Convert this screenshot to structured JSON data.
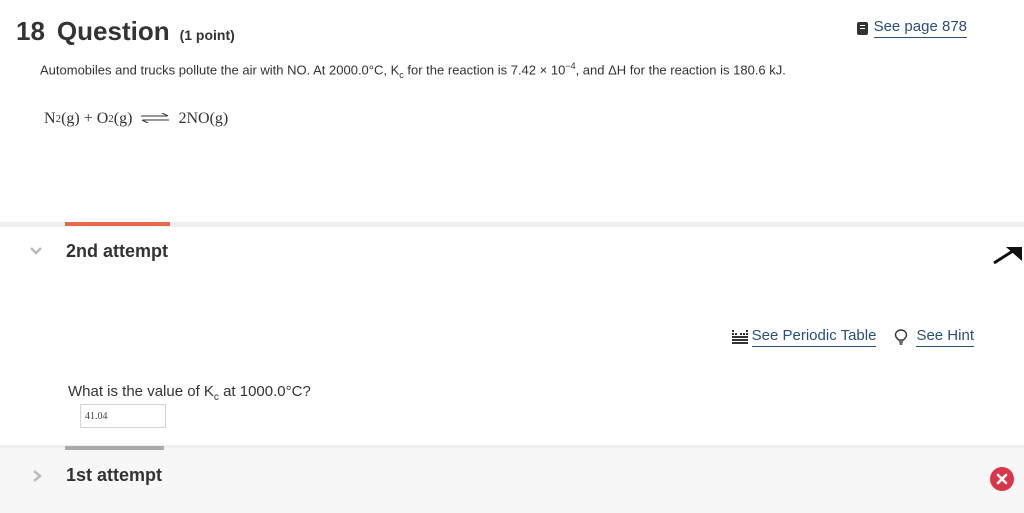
{
  "question": {
    "number": "18",
    "word": "Question",
    "points": "(1 point)"
  },
  "see_page": {
    "label": "See page 878",
    "icon": "book-icon"
  },
  "prompt": {
    "part1": "Automobiles and trucks pollute the air with NO. At 2000.0°C, K",
    "k_sub": "c",
    "part2": " for the reaction is 7.42 × 10",
    "exp": "−4",
    "part3": ", and ΔH",
    "part4": " for the reaction is 180.6 kJ."
  },
  "equation": {
    "n": "N",
    "n_sub": "2",
    "state1": "(g) + O",
    "o_sub": "2",
    "state2": "(g)",
    "product": "2NO(g)"
  },
  "attempt2": {
    "label": "2nd attempt"
  },
  "tools": {
    "periodic_label": "See Periodic Table",
    "hint_label": "See Hint"
  },
  "sub_question": {
    "part1": "What is the value of K",
    "k_sub": "c",
    "part2": " at 1000.0°C?"
  },
  "answer": {
    "value": "41.04"
  },
  "attempt1": {
    "label": "1st attempt",
    "status": "incorrect"
  },
  "colors": {
    "accent": "#e9674a",
    "link": "#2a4f7a",
    "error": "#d9364a"
  }
}
